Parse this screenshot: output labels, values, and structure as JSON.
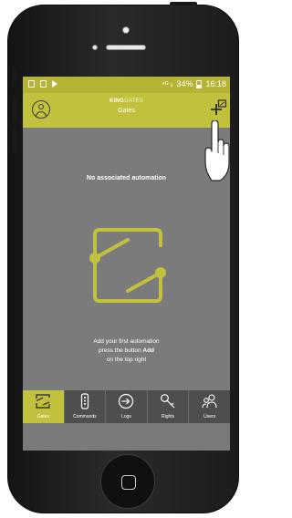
{
  "status_bar": {
    "signal": "⁴ᴳ ᵢₗ",
    "battery": "34%",
    "time": "16:18"
  },
  "app_bar": {
    "brand_primary": "KING",
    "brand_secondary": "GATES",
    "title": "Gates",
    "profile_icon": "user-circle-icon",
    "add_icon": "add-automation-icon"
  },
  "empty_state": {
    "title": "No associated automation",
    "hint_line1": "Add your first automation",
    "hint_line2_prefix": "press the button",
    "hint_line2_button": "Add",
    "hint_line3": "on the top right",
    "illustration_icon": "gate-icon"
  },
  "tabs": [
    {
      "label": "Gates",
      "icon": "gate-icon",
      "active": true
    },
    {
      "label": "Commands",
      "icon": "remote-control-icon",
      "active": false
    },
    {
      "label": "Logs",
      "icon": "login-arrow-icon",
      "active": false
    },
    {
      "label": "Rights",
      "icon": "key-icon",
      "active": false
    },
    {
      "label": "Users",
      "icon": "users-icon",
      "active": false
    }
  ],
  "colors": {
    "accent": "#c2c13d",
    "status_bar": "#b5b435",
    "background": "#7b7b7b",
    "tab_bar": "#4e4e4e"
  }
}
